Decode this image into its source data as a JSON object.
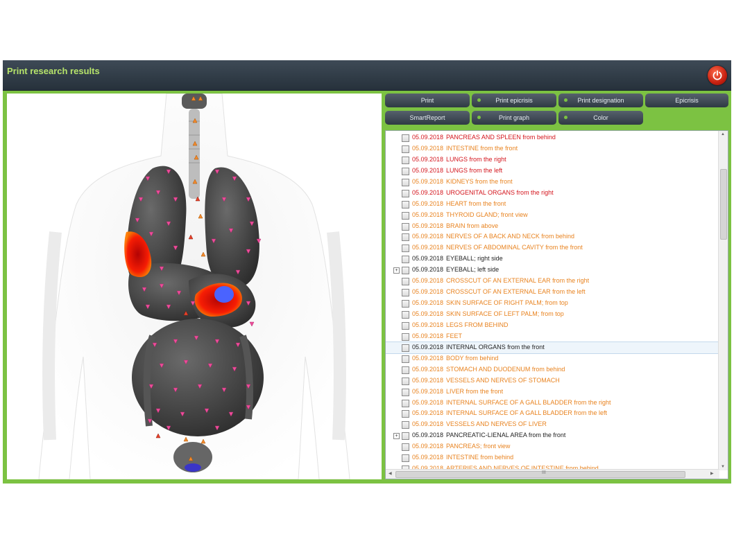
{
  "window": {
    "title": "Print research results"
  },
  "buttons": [
    {
      "label": "Print",
      "led": false
    },
    {
      "label": "Print epicrisis",
      "led": true
    },
    {
      "label": "Print designation",
      "led": true
    },
    {
      "label": "Epicrisis",
      "led": false
    },
    {
      "label": "SmartReport",
      "led": false
    },
    {
      "label": "Print graph",
      "led": true
    },
    {
      "label": "Color",
      "led": true
    }
  ],
  "colors": {
    "accent_green": "#7cc242",
    "title_green": "#b6e36a",
    "red_text": "#d4141c",
    "orange_text": "#e8821e",
    "dark_text": "#222222"
  },
  "studies": [
    {
      "date": "05.09.2018",
      "name": "PANCREAS AND SPLEEN from behind",
      "color": "red"
    },
    {
      "date": "05.09.2018",
      "name": "INTESTINE from the front",
      "color": "orange"
    },
    {
      "date": "05.09.2018",
      "name": "LUNGS from the right",
      "color": "red"
    },
    {
      "date": "05.09.2018",
      "name": "LUNGS from the left",
      "color": "red"
    },
    {
      "date": "05.09.2018",
      "name": "KIDNEYS from the front",
      "color": "orange"
    },
    {
      "date": "05.09.2018",
      "name": "UROGENITAL ORGANS from the right",
      "color": "red"
    },
    {
      "date": "05.09.2018",
      "name": "HEART from the front",
      "color": "orange"
    },
    {
      "date": "05.09.2018",
      "name": "THYROID GLAND; front view",
      "color": "orange"
    },
    {
      "date": "05.09.2018",
      "name": "BRAIN from above",
      "color": "orange"
    },
    {
      "date": "05.09.2018",
      "name": "NERVES OF A BACK AND NECK from behind",
      "color": "orange"
    },
    {
      "date": "05.09.2018",
      "name": "NERVES OF ABDOMINAL CAVITY from the front",
      "color": "orange"
    },
    {
      "date": "05.09.2018",
      "name": "EYEBALL; right side",
      "color": "dark"
    },
    {
      "date": "05.09.2018",
      "name": "EYEBALL; left side",
      "color": "dark",
      "expander": true
    },
    {
      "date": "05.09.2018",
      "name": "CROSSCUT OF AN EXTERNAL EAR from the right",
      "color": "orange"
    },
    {
      "date": "05.09.2018",
      "name": "CROSSCUT OF AN EXTERNAL EAR from the left",
      "color": "orange"
    },
    {
      "date": "05.09.2018",
      "name": "SKIN SURFACE OF RIGHT PALM; from top",
      "color": "orange"
    },
    {
      "date": "05.09.2018",
      "name": "SKIN SURFACE OF LEFT PALM; from top",
      "color": "orange"
    },
    {
      "date": "05.09.2018",
      "name": "LEGS FROM BEHIND",
      "color": "orange"
    },
    {
      "date": "05.09.2018",
      "name": "FEET",
      "color": "orange"
    },
    {
      "date": "05.09.2018",
      "name": "INTERNAL ORGANS  from the front",
      "color": "dark",
      "selected": true
    },
    {
      "date": "05.09.2018",
      "name": "BODY from behind",
      "color": "orange"
    },
    {
      "date": "05.09.2018",
      "name": "STOMACH AND DUODENUM from behind",
      "color": "orange"
    },
    {
      "date": "05.09.2018",
      "name": "VESSELS AND NERVES OF STOMACH",
      "color": "orange"
    },
    {
      "date": "05.09.2018",
      "name": "LIVER from the front",
      "color": "orange"
    },
    {
      "date": "05.09.2018",
      "name": "INTERNAL SURFACE OF A GALL BLADDER from the right",
      "color": "orange"
    },
    {
      "date": "05.09.2018",
      "name": "INTERNAL SURFACE OF A GALL BLADDER from the left",
      "color": "orange"
    },
    {
      "date": "05.09.2018",
      "name": "VESSELS AND NERVES OF LIVER",
      "color": "orange"
    },
    {
      "date": "05.09.2018",
      "name": "PANCREATIC-LIENAL AREA from the front",
      "color": "dark",
      "expander": true
    },
    {
      "date": "05.09.2018",
      "name": "PANCREAS;  front view",
      "color": "orange"
    },
    {
      "date": "05.09.2018",
      "name": "INTESTINE from behind",
      "color": "orange"
    },
    {
      "date": "05.09.2018",
      "name": "ARTERIES AND NERVES OF INTESTINE from behind",
      "color": "orange"
    }
  ],
  "scrollbar": {
    "grip": "III"
  },
  "icons": {
    "power": "power-icon",
    "expander": "expand-plus-icon",
    "checkbox": "checkbox"
  },
  "expander_glyph": "+"
}
